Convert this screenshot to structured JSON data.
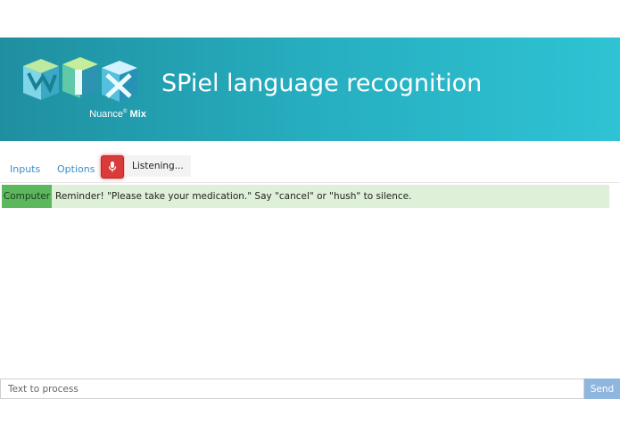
{
  "header": {
    "title": "SPiel language recognition",
    "logo_brand": "Nuance",
    "logo_product": "Mix",
    "logo_letters": "MIX"
  },
  "tabs": [
    {
      "label": "Inputs"
    },
    {
      "label": "Options"
    }
  ],
  "mic": {
    "icon": "microphone-icon",
    "status": "Listening..."
  },
  "messages": [
    {
      "speaker": "Computer",
      "text": "Reminder! \"Please take your medication.\" Say \"cancel\" or \"hush\" to silence."
    }
  ],
  "input": {
    "placeholder": "Text to process",
    "value": ""
  },
  "send": {
    "label": "Send"
  },
  "colors": {
    "banner_start": "#1f8fa0",
    "banner_end": "#2ec3d4",
    "link": "#3a8ec8",
    "mic_active": "#d93a3a",
    "message_bg": "#dff0d8",
    "speaker_bg": "#5cb85c",
    "send_bg": "#8fb6de"
  }
}
